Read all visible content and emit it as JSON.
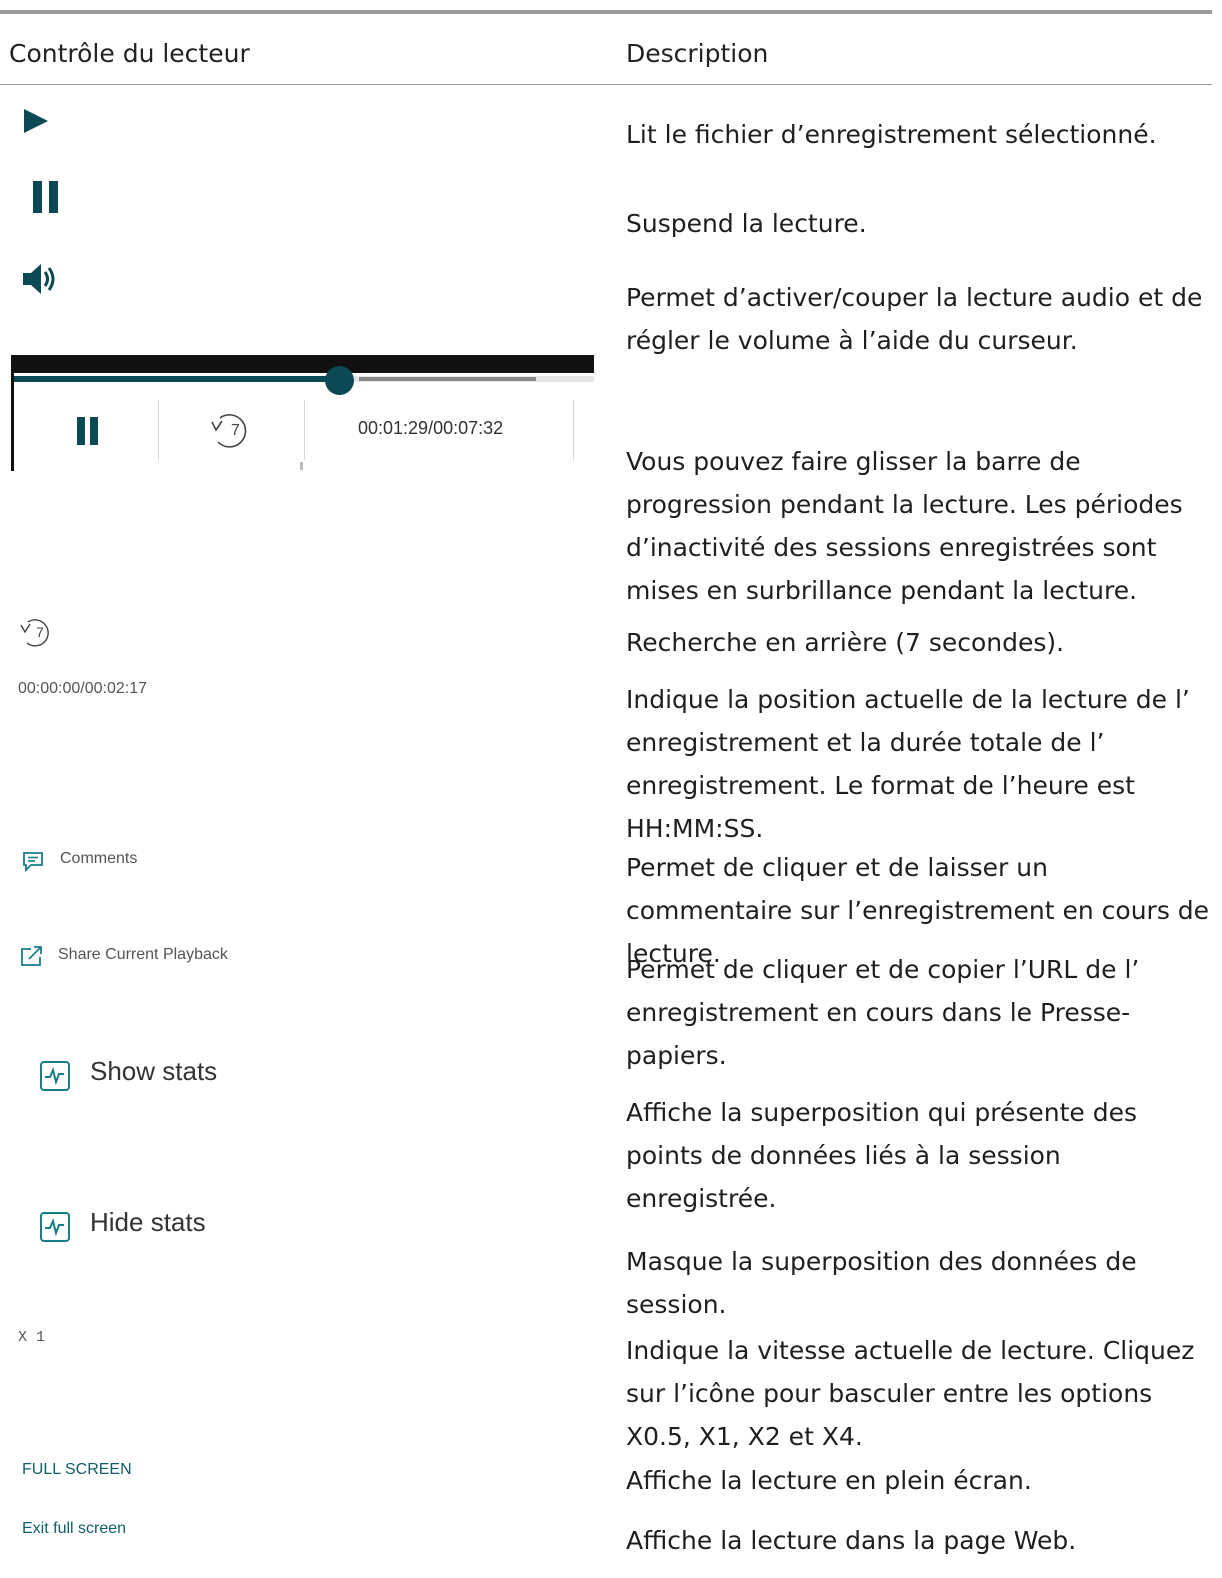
{
  "table": {
    "header": {
      "control": "Contrôle du lecteur",
      "description": "Description"
    },
    "rows": [
      {
        "description": "Lit le fichier d’enregistrement sélectionné."
      },
      {
        "description": "Suspend la lecture."
      },
      {
        "description": "Permet d’activer/couper la lecture audio et de régler le volume à l’aide du curseur."
      },
      {
        "control_time": "00:01:29/00:07:32",
        "description": "Vous pouvez faire glisser la barre de progression pendant la lecture. Les périodes d’inactivité des sessions enregistrées sont mises en surbrillance pendant la lecture."
      },
      {
        "control_text": "7",
        "description": "Recherche en arrière (7 secondes)."
      },
      {
        "control_text": "00:00:00/00:02:17",
        "description": "Indique la position actuelle de la lecture de l’ enregistrement et la durée totale de l’ enregistrement. Le format de l’heure est HH:MM:SS."
      },
      {
        "control_text": "Comments",
        "description": "Permet de cliquer et de laisser un commentaire sur l’enregistrement en cours de lecture."
      },
      {
        "control_text": "Share Current Playback",
        "description": "Permet de cliquer et de copier l’URL de l’ enregistrement en cours dans le Presse-papiers."
      },
      {
        "control_text": "Show stats",
        "description": "Affiche la superposition qui présente des points de données liés à la session enregistrée."
      },
      {
        "control_text": "Hide stats",
        "description": "Masque la superposition des données de session."
      },
      {
        "control_text": "X 1",
        "description": "Indique la vitesse actuelle de lecture. Cliquez sur l’icône pour basculer entre les options X0.5, X1, X2 et X4."
      },
      {
        "control_text": "FULL SCREEN",
        "description": "Affiche la lecture en plein écran."
      },
      {
        "control_text": "Exit full screen",
        "description": "Affiche la lecture dans la page Web."
      }
    ]
  },
  "player_bar": {
    "progress_fraction": 0.56,
    "buffered_fraction": 0.9,
    "rewind_seconds": "7"
  },
  "colors": {
    "accent_teal": "#0b4a55",
    "icon_teal": "#167d8a",
    "rule": "#9a9a9a"
  }
}
